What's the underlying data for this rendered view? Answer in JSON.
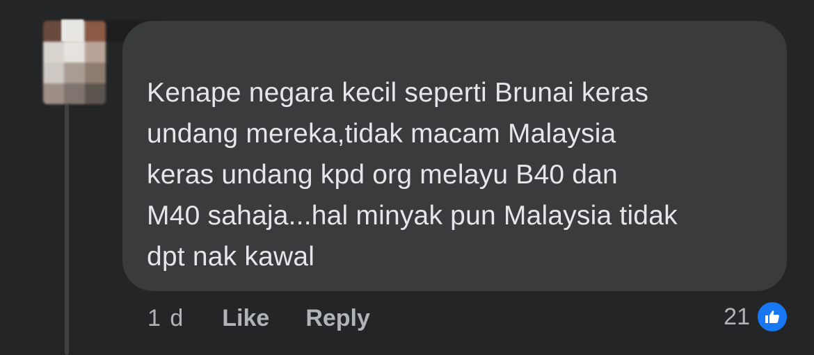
{
  "comment": {
    "text": "Kenape negara kecil seperti Brunai keras\nundang mereka,tidak macam Malaysia\nkeras undang kpd org melayu B40 dan\nM40 sahaja...hal minyak pun Malaysia tidak\ndpt nak kawal",
    "timestamp": "1 d",
    "like_label": "Like",
    "reply_label": "Reply",
    "reaction_count": "21",
    "reaction_icon": "thumbs-up-icon"
  },
  "colors": {
    "background": "#242526",
    "bubble": "#3a3b3c",
    "text": "#e4e6eb",
    "secondary_text": "#b0b3b8",
    "like_blue": "#1877f2"
  }
}
